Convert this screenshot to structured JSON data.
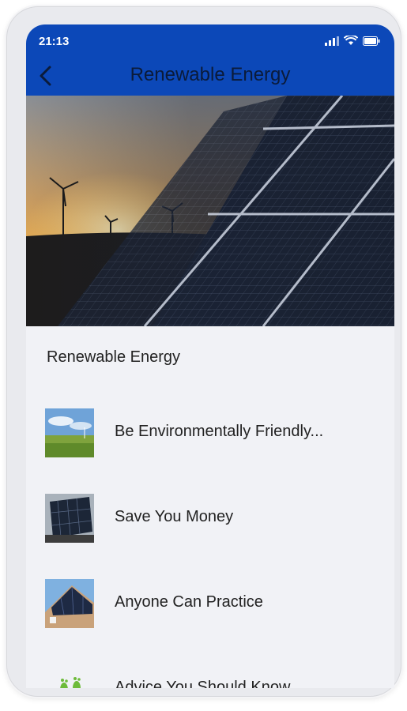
{
  "status": {
    "time": "21:13"
  },
  "header": {
    "title": "Renewable Energy",
    "back_icon": "back-arrow-icon"
  },
  "section": {
    "title": "Renewable Energy"
  },
  "items": [
    {
      "label": "Be Environmentally Friendly...",
      "thumb": "meadow-wind-turbine-thumbnail"
    },
    {
      "label": "Save You Money",
      "thumb": "solar-panel-thumbnail"
    },
    {
      "label": "Anyone Can Practice",
      "thumb": "solar-roof-house-thumbnail"
    },
    {
      "label": "Advice You Should Know",
      "thumb": "footprints-icon"
    }
  ],
  "colors": {
    "appbar": "#0c48b8",
    "background": "#f1f2f6"
  }
}
